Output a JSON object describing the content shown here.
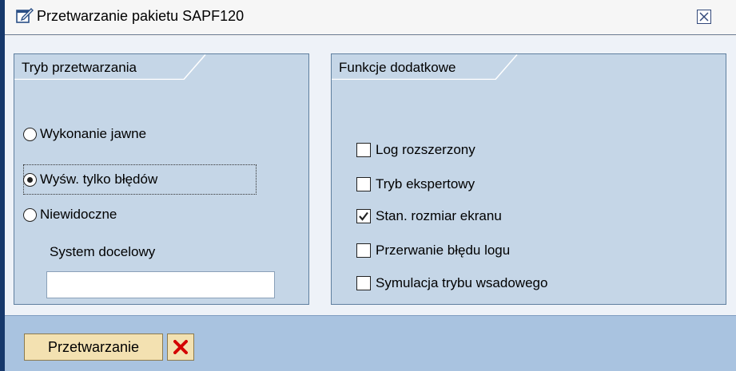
{
  "window": {
    "title": "Przetwarzanie pakietu SAPF120",
    "icons": {
      "title": "edit-window-icon",
      "close": "close-icon"
    }
  },
  "processing_mode": {
    "header": "Tryb przetwarzania",
    "options": [
      {
        "label": "Wykonanie jawne",
        "selected": false
      },
      {
        "label": "Wyśw. tylko błędów",
        "selected": true
      },
      {
        "label": "Niewidoczne",
        "selected": false
      }
    ],
    "target_system": {
      "label": "System docelowy",
      "value": ""
    }
  },
  "additional_functions": {
    "header": "Funkcje dodatkowe",
    "options": [
      {
        "label": "Log rozszerzony",
        "checked": false
      },
      {
        "label": "Tryb ekspertowy",
        "checked": false
      },
      {
        "label": "Stan. rozmiar ekranu",
        "checked": true
      },
      {
        "label": "Przerwanie błędu logu",
        "checked": false
      },
      {
        "label": "Symulacja trybu wsadowego",
        "checked": false
      }
    ]
  },
  "footer": {
    "process_button": "Przetwarzanie",
    "cancel_icon": "cancel-x-icon"
  },
  "colors": {
    "group_background": "#c5d6e7",
    "footer_background": "#a9c3e0",
    "button_background": "#f3e1b1",
    "cancel_red": "#d40000"
  }
}
